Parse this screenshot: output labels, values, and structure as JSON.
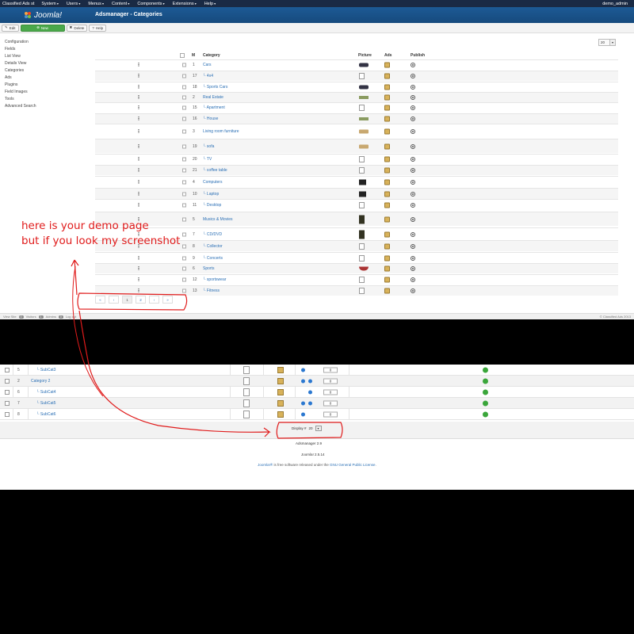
{
  "menubar": {
    "site": "Classified Ads st",
    "items": [
      "System",
      "Users",
      "Menus",
      "Content",
      "Components",
      "Extensions",
      "Help"
    ],
    "user": "demo_admin"
  },
  "header": {
    "logo": "Joomla!",
    "title": "Adsmanager - Categories"
  },
  "toolbar": {
    "edit": "Edit",
    "new": "New",
    "delete": "Delete",
    "help": "Help"
  },
  "sidebar": [
    "Configuration",
    "Fields",
    "List View",
    "Details View",
    "Categories",
    "Ads",
    "Plugins",
    "Field Images",
    "Tools",
    "Advanced Search"
  ],
  "limit": {
    "value": "20"
  },
  "table": {
    "headers": {
      "id": "M",
      "category": "Category",
      "picture": "Picture",
      "ads": "Ads",
      "publish": "Publish"
    },
    "rows": [
      {
        "id": "1",
        "name": "Cars",
        "thumb": "car"
      },
      {
        "id": "17",
        "name": "└ 4x4",
        "thumb": "doc"
      },
      {
        "id": "18",
        "name": "└ Sports Cars",
        "thumb": "car"
      },
      {
        "id": "2",
        "name": "Real Estate",
        "thumb": "house"
      },
      {
        "id": "15",
        "name": "└ Apartment",
        "thumb": "doc"
      },
      {
        "id": "16",
        "name": "└ House",
        "thumb": "house"
      },
      {
        "id": "3",
        "name": "Living room furniture",
        "thumb": "sofa"
      },
      {
        "id": "19",
        "name": "└ sofa",
        "thumb": "sofa"
      },
      {
        "id": "20",
        "name": "└ TV",
        "thumb": "doc"
      },
      {
        "id": "21",
        "name": "└ coffee table",
        "thumb": "doc"
      },
      {
        "id": "4",
        "name": "Computers",
        "thumb": "laptop"
      },
      {
        "id": "10",
        "name": "└ Laptop",
        "thumb": "laptop"
      },
      {
        "id": "11",
        "name": "└ Desktop",
        "thumb": "doc"
      },
      {
        "id": "5",
        "name": "Musics & Movies",
        "thumb": "tall"
      },
      {
        "id": "7",
        "name": "└ CD/DVD",
        "thumb": "tall"
      },
      {
        "id": "8",
        "name": "└ Collector",
        "thumb": "doc"
      },
      {
        "id": "9",
        "name": "└ Concerts",
        "thumb": "doc"
      },
      {
        "id": "6",
        "name": "Sports",
        "thumb": "boat"
      },
      {
        "id": "12",
        "name": "└ sportswear",
        "thumb": "doc"
      },
      {
        "id": "13",
        "name": "└ Fitness",
        "thumb": "doc"
      }
    ]
  },
  "pager": [
    "«",
    "‹",
    "1",
    "2",
    "›",
    "»"
  ],
  "status": {
    "view_site": "View Site",
    "visitors_count": "0",
    "visitors": "Visitors",
    "admins_count": "1",
    "admins": "Admins",
    "messages_count": "0",
    "logout": "Log out",
    "copyright": "© Classified Ads 2013"
  },
  "annotation": {
    "line1": "here is your demo page",
    "line2": "but if you look my screenshot"
  },
  "lower": {
    "rows": [
      {
        "id": "5",
        "name": "└ SubCat3",
        "order": "0"
      },
      {
        "id": "2",
        "name": "Category 2",
        "order": "0"
      },
      {
        "id": "6",
        "name": "└ SubCat4",
        "order": "0"
      },
      {
        "id": "7",
        "name": "└ SubCat5",
        "order": "0"
      },
      {
        "id": "8",
        "name": "└ SubCat6",
        "order": "0"
      }
    ],
    "display_label": "Display #",
    "display_value": "20",
    "adsmanager_version": "Adsmanager 2.9",
    "joomla_version": "Joomla! 2.5.14",
    "license_link1": "Joomla!®",
    "license_mid": " is free software released under the ",
    "license_link2": "GNU General Public License",
    "license_end": "."
  }
}
